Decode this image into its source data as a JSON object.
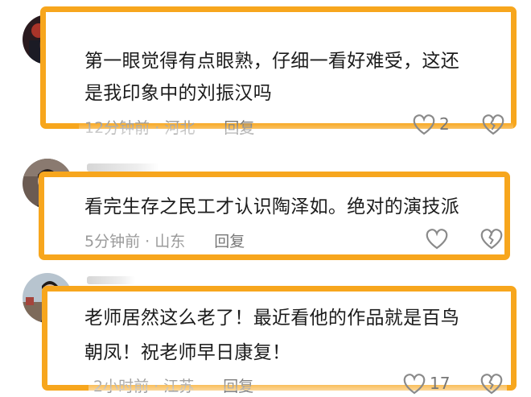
{
  "comments": [
    {
      "text_lines": [
        "第一眼觉得有点眼熟，仔细一看好难受，这还",
        "是我印象中的刘振汉吗"
      ],
      "time": "12分钟前",
      "location": "河北",
      "reply_label": "回复",
      "like_count": "2"
    },
    {
      "text_lines": [
        "看完生存之民工才认识陶泽如。绝对的演技派"
      ],
      "time": "5分钟前",
      "location": "山东",
      "reply_label": "回复",
      "like_count": ""
    },
    {
      "text_lines": [
        "老师居然这么老了！最近看他的作品就是百鸟",
        "朝凤！祝老师早日康复！"
      ],
      "time": "2小时前",
      "location": "江苏",
      "reply_label": "回复",
      "like_count": "17"
    }
  ],
  "colors": {
    "highlight_frame": "#f7a61d",
    "meta_text": "#9a9a9a",
    "icon_stroke": "#8a8a8a"
  },
  "icons": [
    "heart-icon",
    "broken-heart-icon"
  ]
}
